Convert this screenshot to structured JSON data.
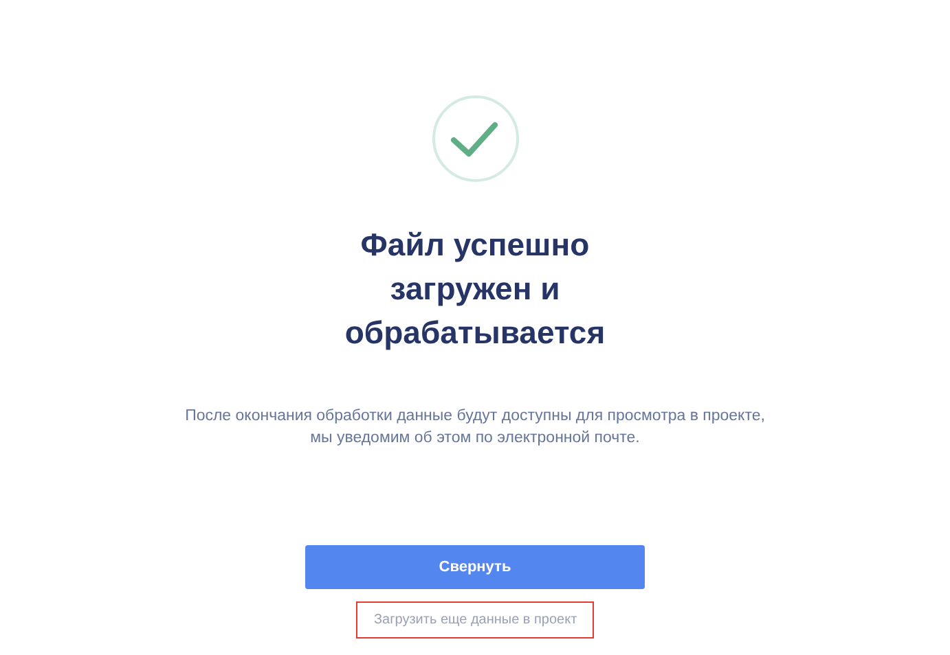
{
  "title": [
    "Файл успешно",
    "загружен и",
    "обрабатывается"
  ],
  "message": [
    "После окончания обработки данные будут доступны для просмотра в проекте,",
    "мы уведомим об этом по электронной почте."
  ],
  "primary_button": "Свернуть",
  "secondary_link": {
    "label": "Загрузить еще данные в проект",
    "highlighted": true
  }
}
